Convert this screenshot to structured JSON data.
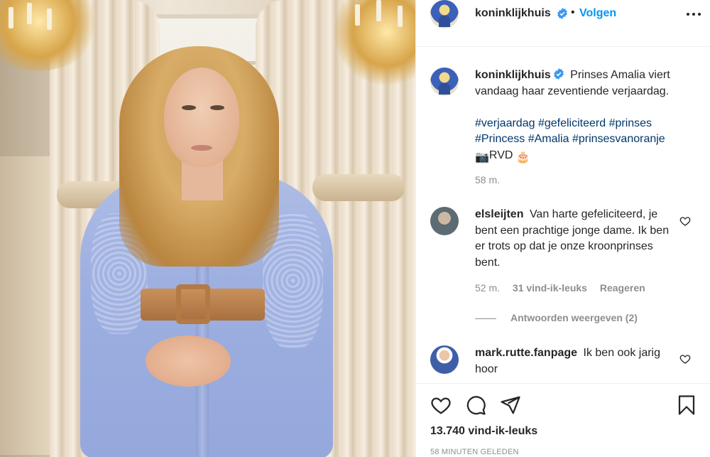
{
  "post": {
    "photo_alt": "Prinses Amalia portret",
    "author": "koninklijkhuis",
    "follow_label": "Volgen",
    "separator": "•"
  },
  "caption": {
    "username": "koninklijkhuis",
    "text": "Prinses Amalia viert vandaag haar zeventiende verjaardag.",
    "hashtags_line1": "#verjaardag #gefeliciteerd #prinses",
    "hashtags_line2": "#Princess #Amalia #prinsesvanoranje",
    "credit": "RVD",
    "camera_emoji": "📷",
    "cake_emoji": "🎂",
    "time": "58 m."
  },
  "comments": [
    {
      "username": "elsleijten",
      "text": "Van harte gefeliciteerd, je bent een prachtige jonge dame. Ik ben er trots op dat je onze kroonprinses bent.",
      "time": "52 m.",
      "likes": "31 vind-ik-leuks",
      "reply_label": "Reageren",
      "view_replies": "Antwoorden weergeven (2)"
    },
    {
      "username": "mark.rutte.fanpage",
      "text": "Ik ben ook jarig hoor"
    }
  ],
  "footer": {
    "likes": "13.740 vind-ik-leuks",
    "posted": "58 MINUTEN GELEDEN"
  },
  "colors": {
    "link": "#0095f6",
    "hashtag": "#00376b",
    "muted": "#8e8e8e",
    "text": "#262626"
  },
  "icons": [
    "verified-badge-icon",
    "more-options-icon",
    "heart-icon",
    "comment-icon",
    "share-icon",
    "bookmark-icon"
  ]
}
